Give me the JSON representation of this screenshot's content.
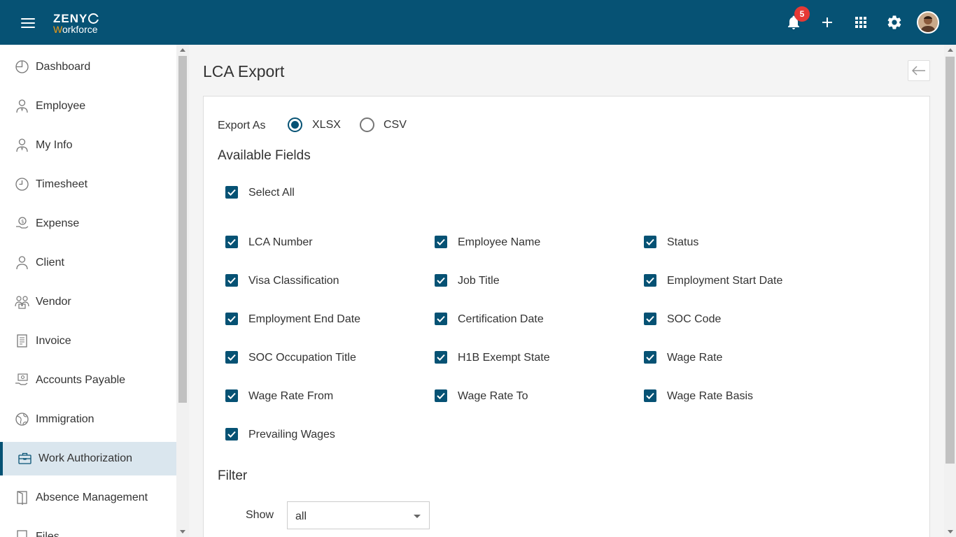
{
  "header": {
    "logo_top": "ZENY",
    "logo_w": "W",
    "logo_rest": "orkforce",
    "notification_count": "5"
  },
  "sidebar": {
    "items": [
      {
        "label": "Dashboard",
        "icon": "dashboard-icon"
      },
      {
        "label": "Employee",
        "icon": "employee-icon"
      },
      {
        "label": "My Info",
        "icon": "my-info-icon"
      },
      {
        "label": "Timesheet",
        "icon": "clock-icon"
      },
      {
        "label": "Expense",
        "icon": "expense-icon"
      },
      {
        "label": "Client",
        "icon": "client-icon"
      },
      {
        "label": "Vendor",
        "icon": "vendor-icon"
      },
      {
        "label": "Invoice",
        "icon": "invoice-icon"
      },
      {
        "label": "Accounts Payable",
        "icon": "accounts-payable-icon"
      },
      {
        "label": "Immigration",
        "icon": "globe-icon"
      },
      {
        "label": "Work Authorization",
        "icon": "briefcase-icon",
        "active": true
      },
      {
        "label": "Absence Management",
        "icon": "door-icon"
      },
      {
        "label": "Files",
        "icon": "files-icon"
      }
    ]
  },
  "main": {
    "title": "LCA Export",
    "export_as_label": "Export As",
    "formats": [
      {
        "label": "XLSX",
        "checked": true
      },
      {
        "label": "CSV",
        "checked": false
      }
    ],
    "available_fields_title": "Available Fields",
    "select_all_label": "Select All",
    "fields": [
      [
        "LCA Number",
        "Employee Name",
        "Status"
      ],
      [
        "Visa Classification",
        "Job Title",
        "Employment Start Date"
      ],
      [
        "Employment End Date",
        "Certification Date",
        "SOC Code"
      ],
      [
        "SOC Occupation Title",
        "H1B Exempt State",
        "Wage Rate"
      ],
      [
        "Wage Rate From",
        "Wage Rate To",
        "Wage Rate Basis"
      ],
      [
        "Prevailing Wages"
      ]
    ],
    "filter_title": "Filter",
    "show_label": "Show",
    "show_value": "all"
  },
  "colors": {
    "primary": "#065274",
    "badge": "#e53935",
    "active_bg": "#dae6ee"
  }
}
